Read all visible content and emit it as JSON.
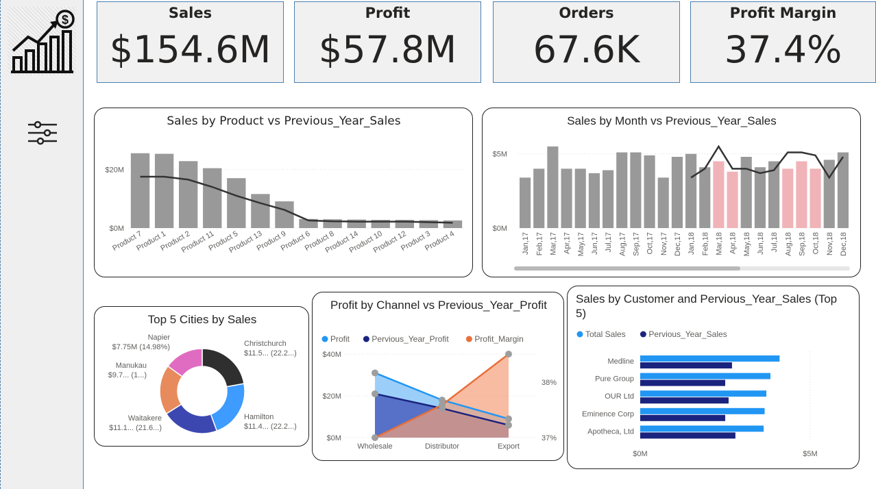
{
  "sidebar": {
    "logo_icon": "sales-growth-chart-icon",
    "filter_icon": "sliders-filter-icon"
  },
  "kpis": [
    {
      "title": "Sales",
      "value": "$154.6M"
    },
    {
      "title": "Profit",
      "value": "$57.8M"
    },
    {
      "title": "Orders",
      "value": "67.6K"
    },
    {
      "title": "Profit Margin",
      "value": "37.4%"
    }
  ],
  "colors": {
    "bar_gray": "#999999",
    "bar_pink": "#f0b3b8",
    "line_dark": "#333333",
    "profit_blue": "#2196f3",
    "prev_navy": "#1a237e",
    "margin_orange": "#e8703a"
  },
  "chart_data": [
    {
      "type": "bar",
      "title": "Sales by Product vs Previous_Year_Sales",
      "categories": [
        "Product 7",
        "Product 1",
        "Product 2",
        "Product 11",
        "Product 5",
        "Product 13",
        "Product 9",
        "Product 6",
        "Product 8",
        "Product 14",
        "Product 10",
        "Product 12",
        "Product 3",
        "Product 4"
      ],
      "series": [
        {
          "values": [
            25.5,
            25.3,
            22.8,
            20.4,
            17.0,
            11.6,
            9.1,
            3.1,
            3.0,
            2.9,
            2.8,
            2.8,
            2.7,
            2.6
          ]
        },
        {
          "values": [
            17.5,
            17.5,
            16.5,
            14.0,
            11.0,
            8.5,
            6.2,
            2.6,
            2.3,
            2.2,
            2.2,
            2.2,
            2.0,
            1.8
          ]
        }
      ],
      "yticks": [
        "$0M",
        "$20M"
      ],
      "ylim": [
        0,
        28
      ]
    },
    {
      "type": "bar",
      "title": "Sales by Month vs Previous_Year_Sales",
      "categories": [
        "Jan,17",
        "Feb,17",
        "Mar,17",
        "Apr,17",
        "May,17",
        "Jun,17",
        "Jul,17",
        "Aug,17",
        "Sep,17",
        "Oct,17",
        "Nov,17",
        "Dec,17",
        "Jan,18",
        "Feb,18",
        "Mar,18",
        "Apr,18",
        "May,18",
        "Jun,18",
        "Jul,18",
        "Aug,18",
        "Sep,18",
        "Oct,18",
        "Nov,18",
        "Dec,18"
      ],
      "series": [
        {
          "values": [
            3.4,
            4.0,
            5.5,
            4.0,
            4.0,
            3.7,
            3.9,
            5.1,
            5.1,
            4.9,
            3.4,
            4.8,
            5.0,
            4.1,
            4.5,
            3.8,
            4.8,
            4.1,
            4.5,
            4.0,
            4.5,
            4.0,
            4.6,
            5.1
          ]
        },
        {
          "values": [
            null,
            null,
            null,
            null,
            null,
            null,
            null,
            null,
            null,
            null,
            null,
            null,
            3.4,
            4.0,
            5.5,
            4.0,
            4.0,
            3.7,
            3.9,
            5.1,
            5.1,
            4.9,
            3.4,
            4.8
          ]
        }
      ],
      "highlight": [
        false,
        false,
        false,
        false,
        false,
        false,
        false,
        false,
        false,
        false,
        false,
        false,
        false,
        false,
        true,
        true,
        false,
        false,
        false,
        true,
        true,
        true,
        false,
        false
      ],
      "yticks": [
        "$0M",
        "$5M"
      ],
      "ylim": [
        0,
        6
      ]
    },
    {
      "type": "pie",
      "title": "Top 5 Cities by Sales",
      "slices": [
        {
          "name": "Christchurch",
          "label": "$11.5... (22.2...)",
          "value": 22.2,
          "color": "#2f2f2f"
        },
        {
          "name": "Hamilton",
          "label": "$11.4... (22.2...)",
          "value": 22.2,
          "color": "#3e9bff"
        },
        {
          "name": "Waitakere",
          "label": "$11.1... (21.6...)",
          "value": 21.6,
          "color": "#3c48b0"
        },
        {
          "name": "Manukau",
          "label": "$9.7... (1...)",
          "value": 19.0,
          "color": "#e88b5c"
        },
        {
          "name": "Napier",
          "label": "$7.75M (14.98%)",
          "value": 14.98,
          "color": "#e06cc2"
        }
      ]
    },
    {
      "type": "area",
      "title": "Profit by Channel vs Previous_Year_Profit",
      "legend": [
        "Profit",
        "Pervious_Year_Profit",
        "Profit_Margin"
      ],
      "categories": [
        "Wholesale",
        "Distributor",
        "Export"
      ],
      "series": [
        {
          "name": "Profit",
          "values": [
            31,
            18,
            9
          ]
        },
        {
          "name": "Pervious_Year_Profit",
          "values": [
            21,
            14,
            6
          ]
        },
        {
          "name": "Profit_Margin",
          "values": [
            36.95,
            37.4,
            38.1
          ]
        }
      ],
      "yticks_left": [
        "$0M",
        "$20M",
        "$40M"
      ],
      "yticks_right": [
        "37%",
        "38%"
      ]
    },
    {
      "type": "bar",
      "title": "Sales by Customer and Pervious_Year_Sales (Top 5)",
      "legend": [
        "Total Sales",
        "Pervious_Year_Sales"
      ],
      "categories": [
        "Medline",
        "Pure Group",
        "OUR Ltd",
        "Eminence Corp",
        "Apotheca, Ltd"
      ],
      "series": [
        {
          "name": "Total Sales",
          "values": [
            4.1,
            3.83,
            3.71,
            3.66,
            3.63
          ]
        },
        {
          "name": "Pervious_Year_Sales",
          "values": [
            2.7,
            2.5,
            2.6,
            2.5,
            2.8
          ]
        }
      ],
      "xticks": [
        "$0M",
        "$5M"
      ]
    }
  ]
}
